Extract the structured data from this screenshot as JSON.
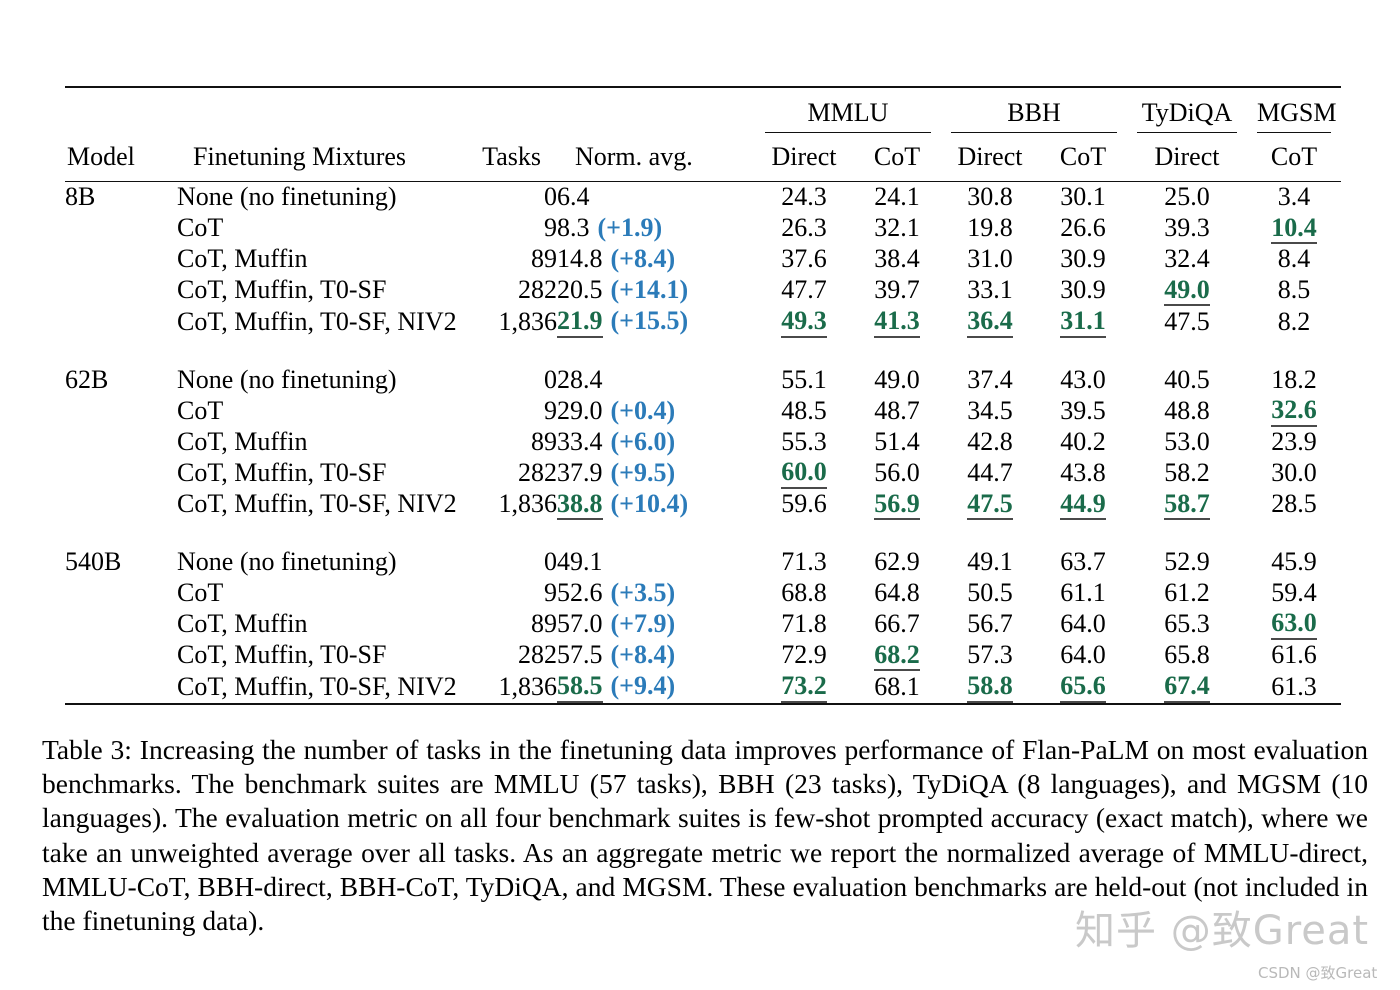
{
  "table": {
    "group_headers": [
      {
        "label": "MMLU",
        "span": 2
      },
      {
        "label": "BBH",
        "span": 2
      },
      {
        "label": "TyDiQA",
        "span": 1
      },
      {
        "label": "MGSM",
        "span": 1
      }
    ],
    "columns": {
      "model": "Model",
      "mixtures": "Finetuning Mixtures",
      "tasks": "Tasks",
      "norm_avg": "Norm. avg.",
      "mmlu_direct": "Direct",
      "mmlu_cot": "CoT",
      "bbh_direct": "Direct",
      "bbh_cot": "CoT",
      "tydiqa_direct": "Direct",
      "mgsm_cot": "CoT"
    },
    "blocks": [
      {
        "model": "8B",
        "rows": [
          {
            "mixture": "None (no finetuning)",
            "tasks": "0",
            "norm": "6.4",
            "norm_bold": false,
            "delta": "",
            "cells": [
              {
                "v": "24.3",
                "b": false
              },
              {
                "v": "24.1",
                "b": false
              },
              {
                "v": "30.8",
                "b": false
              },
              {
                "v": "30.1",
                "b": false
              },
              {
                "v": "25.0",
                "b": false
              },
              {
                "v": "3.4",
                "b": false
              }
            ]
          },
          {
            "mixture": "CoT",
            "tasks": "9",
            "norm": "8.3",
            "norm_bold": false,
            "delta": "(+1.9)",
            "cells": [
              {
                "v": "26.3",
                "b": false
              },
              {
                "v": "32.1",
                "b": false
              },
              {
                "v": "19.8",
                "b": false
              },
              {
                "v": "26.6",
                "b": false
              },
              {
                "v": "39.3",
                "b": false
              },
              {
                "v": "10.4",
                "b": true
              }
            ]
          },
          {
            "mixture": "CoT, Muffin",
            "tasks": "89",
            "norm": "14.8",
            "norm_bold": false,
            "delta": "(+8.4)",
            "cells": [
              {
                "v": "37.6",
                "b": false
              },
              {
                "v": "38.4",
                "b": false
              },
              {
                "v": "31.0",
                "b": false
              },
              {
                "v": "30.9",
                "b": false
              },
              {
                "v": "32.4",
                "b": false
              },
              {
                "v": "8.4",
                "b": false
              }
            ]
          },
          {
            "mixture": "CoT, Muffin, T0-SF",
            "tasks": "282",
            "norm": "20.5",
            "norm_bold": false,
            "delta": "(+14.1)",
            "cells": [
              {
                "v": "47.7",
                "b": false
              },
              {
                "v": "39.7",
                "b": false
              },
              {
                "v": "33.1",
                "b": false
              },
              {
                "v": "30.9",
                "b": false
              },
              {
                "v": "49.0",
                "b": true
              },
              {
                "v": "8.5",
                "b": false
              }
            ]
          },
          {
            "mixture": "CoT, Muffin, T0-SF, NIV2",
            "tasks": "1,836",
            "norm": "21.9",
            "norm_bold": true,
            "delta": "(+15.5)",
            "cells": [
              {
                "v": "49.3",
                "b": true
              },
              {
                "v": "41.3",
                "b": true
              },
              {
                "v": "36.4",
                "b": true
              },
              {
                "v": "31.1",
                "b": true
              },
              {
                "v": "47.5",
                "b": false
              },
              {
                "v": "8.2",
                "b": false
              }
            ]
          }
        ]
      },
      {
        "model": "62B",
        "rows": [
          {
            "mixture": "None (no finetuning)",
            "tasks": "0",
            "norm": "28.4",
            "norm_bold": false,
            "delta": "",
            "cells": [
              {
                "v": "55.1",
                "b": false
              },
              {
                "v": "49.0",
                "b": false
              },
              {
                "v": "37.4",
                "b": false
              },
              {
                "v": "43.0",
                "b": false
              },
              {
                "v": "40.5",
                "b": false
              },
              {
                "v": "18.2",
                "b": false
              }
            ]
          },
          {
            "mixture": "CoT",
            "tasks": "9",
            "norm": "29.0",
            "norm_bold": false,
            "delta": "(+0.4)",
            "cells": [
              {
                "v": "48.5",
                "b": false
              },
              {
                "v": "48.7",
                "b": false
              },
              {
                "v": "34.5",
                "b": false
              },
              {
                "v": "39.5",
                "b": false
              },
              {
                "v": "48.8",
                "b": false
              },
              {
                "v": "32.6",
                "b": true
              }
            ]
          },
          {
            "mixture": "CoT, Muffin",
            "tasks": "89",
            "norm": "33.4",
            "norm_bold": false,
            "delta": "(+6.0)",
            "cells": [
              {
                "v": "55.3",
                "b": false
              },
              {
                "v": "51.4",
                "b": false
              },
              {
                "v": "42.8",
                "b": false
              },
              {
                "v": "40.2",
                "b": false
              },
              {
                "v": "53.0",
                "b": false
              },
              {
                "v": "23.9",
                "b": false
              }
            ]
          },
          {
            "mixture": "CoT, Muffin, T0-SF",
            "tasks": "282",
            "norm": "37.9",
            "norm_bold": false,
            "delta": "(+9.5)",
            "cells": [
              {
                "v": "60.0",
                "b": true
              },
              {
                "v": "56.0",
                "b": false
              },
              {
                "v": "44.7",
                "b": false
              },
              {
                "v": "43.8",
                "b": false
              },
              {
                "v": "58.2",
                "b": false
              },
              {
                "v": "30.0",
                "b": false
              }
            ]
          },
          {
            "mixture": "CoT, Muffin, T0-SF, NIV2",
            "tasks": "1,836",
            "norm": "38.8",
            "norm_bold": true,
            "delta": "(+10.4)",
            "cells": [
              {
                "v": "59.6",
                "b": false
              },
              {
                "v": "56.9",
                "b": true
              },
              {
                "v": "47.5",
                "b": true
              },
              {
                "v": "44.9",
                "b": true
              },
              {
                "v": "58.7",
                "b": true
              },
              {
                "v": "28.5",
                "b": false
              }
            ]
          }
        ]
      },
      {
        "model": "540B",
        "rows": [
          {
            "mixture": "None (no finetuning)",
            "tasks": "0",
            "norm": "49.1",
            "norm_bold": false,
            "delta": "",
            "cells": [
              {
                "v": "71.3",
                "b": false
              },
              {
                "v": "62.9",
                "b": false
              },
              {
                "v": "49.1",
                "b": false
              },
              {
                "v": "63.7",
                "b": false
              },
              {
                "v": "52.9",
                "b": false
              },
              {
                "v": "45.9",
                "b": false
              }
            ]
          },
          {
            "mixture": "CoT",
            "tasks": "9",
            "norm": "52.6",
            "norm_bold": false,
            "delta": "(+3.5)",
            "cells": [
              {
                "v": "68.8",
                "b": false
              },
              {
                "v": "64.8",
                "b": false
              },
              {
                "v": "50.5",
                "b": false
              },
              {
                "v": "61.1",
                "b": false
              },
              {
                "v": "61.2",
                "b": false
              },
              {
                "v": "59.4",
                "b": false
              }
            ]
          },
          {
            "mixture": "CoT, Muffin",
            "tasks": "89",
            "norm": "57.0",
            "norm_bold": false,
            "delta": "(+7.9)",
            "cells": [
              {
                "v": "71.8",
                "b": false
              },
              {
                "v": "66.7",
                "b": false
              },
              {
                "v": "56.7",
                "b": false
              },
              {
                "v": "64.0",
                "b": false
              },
              {
                "v": "65.3",
                "b": false
              },
              {
                "v": "63.0",
                "b": true
              }
            ]
          },
          {
            "mixture": "CoT, Muffin, T0-SF",
            "tasks": "282",
            "norm": "57.5",
            "norm_bold": false,
            "delta": "(+8.4)",
            "cells": [
              {
                "v": "72.9",
                "b": false
              },
              {
                "v": "68.2",
                "b": true
              },
              {
                "v": "57.3",
                "b": false
              },
              {
                "v": "64.0",
                "b": false
              },
              {
                "v": "65.8",
                "b": false
              },
              {
                "v": "61.6",
                "b": false
              }
            ]
          },
          {
            "mixture": "CoT, Muffin, T0-SF, NIV2",
            "tasks": "1,836",
            "norm": "58.5",
            "norm_bold": true,
            "delta": "(+9.4)",
            "cells": [
              {
                "v": "73.2",
                "b": true
              },
              {
                "v": "68.1",
                "b": false
              },
              {
                "v": "58.8",
                "b": true
              },
              {
                "v": "65.6",
                "b": true
              },
              {
                "v": "67.4",
                "b": true
              },
              {
                "v": "61.3",
                "b": false
              }
            ]
          }
        ]
      }
    ]
  },
  "caption": {
    "label": "Table 3:",
    "text": "Increasing the number of tasks in the finetuning data improves performance of Flan-PaLM on most evaluation benchmarks. The benchmark suites are MMLU (57 tasks), BBH (23 tasks), TyDiQA (8 languages), and MGSM (10 languages). The evaluation metric on all four benchmark suites is few-shot prompted accuracy (exact match), where we take an unweighted average over all tasks. As an aggregate metric we report the normalized average of MMLU-direct, MMLU-CoT, BBH-direct, BBH-CoT, TyDiQA, and MGSM. These evaluation benchmarks are held-out (not included in the finetuning data)."
  },
  "watermarks": {
    "zhihu": "知乎 @致Great",
    "csdn": "CSDN @致Great"
  },
  "colors": {
    "best_green": "#1a6b4a",
    "delta_blue": "#2b7bb9",
    "rule": "#111111",
    "watermark": "#c9c9c9"
  }
}
